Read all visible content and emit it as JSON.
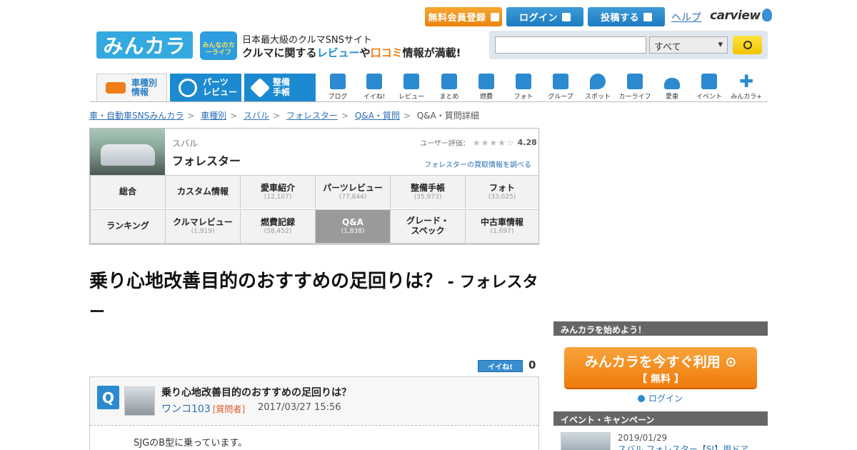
{
  "header": {
    "register_label": "無料会員登録",
    "login_label": "ログイン",
    "post_label": "投稿する",
    "help_label": "ヘルプ",
    "carview_label": "carview",
    "logo_text": "みんカラ",
    "carlife_text": "みんなのカーライフ",
    "tagline_1": "日本最大級のクルマSNSサイト",
    "tagline_2a": "クルマに関する",
    "tagline_2b": "レビュー",
    "tagline_2c": "や",
    "tagline_2d": "口コミ",
    "tagline_2e": "情報が満載!",
    "search": {
      "value": "",
      "select": "すべて"
    }
  },
  "nav": {
    "tabs": [
      {
        "label": "車種別\n情報",
        "l1": "車種別",
        "l2": "情報"
      },
      {
        "l1": "パーツ",
        "l2": "レビュー"
      },
      {
        "l1": "整備",
        "l2": "手帳"
      }
    ],
    "items": [
      "ブログ",
      "イイね!",
      "レビュー",
      "まとめ",
      "燃費",
      "フォト",
      "グループ",
      "スポット",
      "カーライフ",
      "愛車",
      "イベント",
      "みんカラ+"
    ]
  },
  "breadcrumb": [
    "車・自動車SNSみんカラ",
    "車種別",
    "スバル",
    "フォレスター",
    "Q&A・質問",
    "Q&A・質問詳細"
  ],
  "car": {
    "maker": "スバル",
    "model": "フォレスター",
    "rating_label": "ユーザー評価：",
    "rating_value": 4.28,
    "rating_text": "4.28",
    "buy_link": "フォレスターの買取情報を調べる",
    "menu": [
      {
        "label": "総合",
        "count": ""
      },
      {
        "label": "カスタム情報",
        "count": ""
      },
      {
        "label": "愛車紹介",
        "count": "(12,107)"
      },
      {
        "label": "パーツレビュー",
        "count": "(77,844)"
      },
      {
        "label": "整備手帳",
        "count": "(35,973)"
      },
      {
        "label": "フォト",
        "count": "(33,025)"
      },
      {
        "label": "ランキング",
        "count": ""
      },
      {
        "label": "クルマレビュー",
        "count": "(1,919)"
      },
      {
        "label": "燃費記録",
        "count": "(58,452)"
      },
      {
        "label": "Q&A",
        "count": "(1,838)"
      },
      {
        "label": "グレード・スペック",
        "count": ""
      },
      {
        "label": "中古車情報",
        "count": "(1,697)"
      }
    ]
  },
  "page": {
    "title": "乗り心地改善目的のおすすめの足回りは？",
    "title_suffix": " - フォレスター",
    "iine_label": "イイね!",
    "iine_count": "0"
  },
  "question": {
    "icon": "Q",
    "title": "乗り心地改善目的のおすすめの足回りは？",
    "user": "ワンコ103",
    "role": "[質問者]",
    "date": "2017/03/27 15:56",
    "body": "SJGのB型に乗っています。"
  },
  "sidebar": {
    "start_heading": "みんカラを始めよう！",
    "use_btn_l1": "みんカラを今すぐ利用",
    "use_btn_l2": "【 無料 】",
    "login_link": "ログイン",
    "event_heading": "イベント・キャンペーン",
    "event_date": "2019/01/29",
    "event_title": "スバル フォレスター【SJ】用ドア"
  },
  "colors": {
    "accent_blue": "#1c8ad0",
    "accent_orange": "#ef7b0a"
  }
}
